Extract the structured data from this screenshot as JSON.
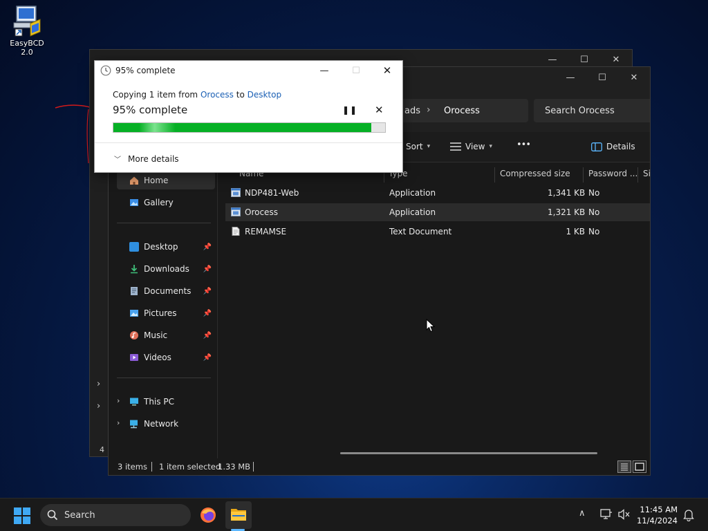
{
  "desktop": {
    "icon_label": "EasyBCD 2.0"
  },
  "back_window": {
    "status_count": "4"
  },
  "explorer": {
    "breadcrumb_prev": "ads",
    "breadcrumb_current": "Orocess",
    "search_placeholder": "Search Orocess",
    "toolbar": {
      "sort": "Sort",
      "view": "View",
      "more": "•••",
      "details": "Details"
    },
    "nav": {
      "home": "Home",
      "gallery": "Gallery",
      "quick_access": [
        {
          "label": "Desktop"
        },
        {
          "label": "Downloads"
        },
        {
          "label": "Documents"
        },
        {
          "label": "Pictures"
        },
        {
          "label": "Music"
        },
        {
          "label": "Videos"
        }
      ],
      "this_pc": "This PC",
      "network": "Network"
    },
    "columns": {
      "name": "Name",
      "type": "Type",
      "compressed_size": "Compressed size",
      "password": "Password ...",
      "size": "Si"
    },
    "files": [
      {
        "name": "NDP481-Web",
        "type": "Application",
        "compressed": "1,341 KB",
        "password": "No"
      },
      {
        "name": "Orocess",
        "type": "Application",
        "compressed": "1,321 KB",
        "password": "No"
      },
      {
        "name": "REMAMSE",
        "type": "Text Document",
        "compressed": "1 KB",
        "password": "No"
      }
    ],
    "status": {
      "items": "3 items",
      "selected": "1 item selected",
      "size": "1.33 MB"
    }
  },
  "copy_dialog": {
    "title": "95% complete",
    "copy_prefix": "Copying 1 item from",
    "source": "Orocess",
    "to_word": "to",
    "destination": "Desktop",
    "percent_text": "95% complete",
    "progress_percent": 95,
    "more_details": "More details"
  },
  "taskbar": {
    "search_label": "Search",
    "time": "11:45 AM",
    "date": "11/4/2024"
  },
  "colors": {
    "progress_green": "#06b025",
    "link_blue": "#1a5fb4",
    "accent": "#5cb8ff"
  }
}
